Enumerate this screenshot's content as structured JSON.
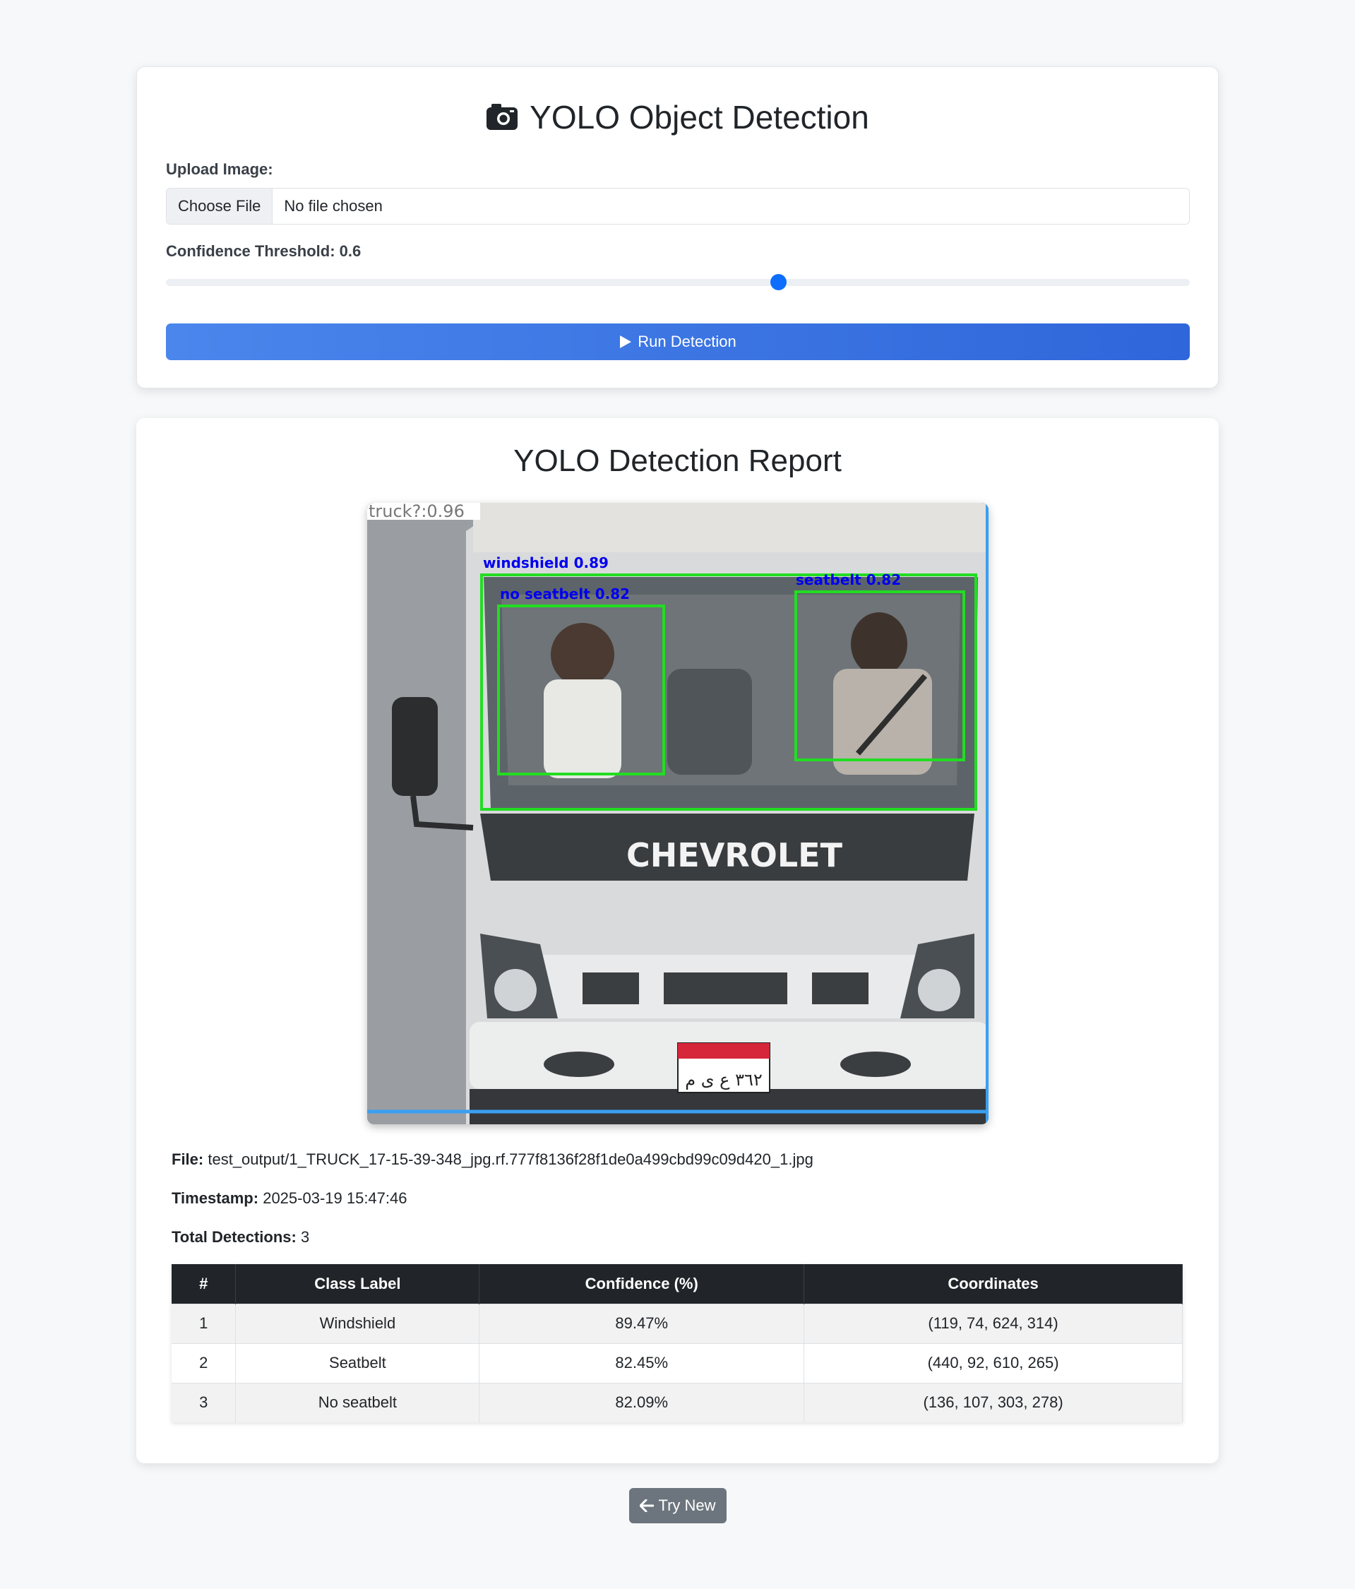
{
  "upload_card": {
    "title": "YOLO Object Detection",
    "upload_label": "Upload Image:",
    "file_button": "Choose File",
    "file_status": "No file chosen",
    "confidence_label": "Confidence Threshold: 0.6",
    "confidence_value": 0.6,
    "run_button": "Run Detection",
    "icons": {
      "title": "camera-icon",
      "run": "play-icon"
    }
  },
  "report": {
    "title": "YOLO Detection Report",
    "image": {
      "overlay_labels": {
        "truck": "truck?:0.96",
        "windshield": "windshield 0.89",
        "no_seatbelt": "no seatbelt 0.82",
        "seatbelt": "seatbelt 0.82"
      },
      "grille_text": "CHEVROLET",
      "plate_text": "٣٦٢ ع ى م"
    },
    "file_label": "File:",
    "file_value": "test_output/1_TRUCK_17-15-39-348_jpg.rf.777f8136f28f1de0a499cbd99c09d420_1.jpg",
    "timestamp_label": "Timestamp:",
    "timestamp_value": "2025-03-19 15:47:46",
    "total_label": "Total Detections:",
    "total_value": "3",
    "table": {
      "headers": [
        "#",
        "Class Label",
        "Confidence (%)",
        "Coordinates"
      ],
      "rows": [
        [
          "1",
          "Windshield",
          "89.47%",
          "(119, 74, 624, 314)"
        ],
        [
          "2",
          "Seatbelt",
          "82.45%",
          "(440, 92, 610, 265)"
        ],
        [
          "3",
          "No seatbelt",
          "82.09%",
          "(136, 107, 303, 278)"
        ]
      ]
    }
  },
  "try_new": {
    "label": "Try New",
    "icon": "arrow-left-icon"
  },
  "colors": {
    "primary": "#0d6efd",
    "button_gradient_start": "#4a86ec",
    "button_gradient_end": "#2f66da",
    "table_header": "#212529",
    "secondary_button": "#6c757d",
    "detection_box": "#22dd22",
    "detection_label": "#0000ee"
  }
}
